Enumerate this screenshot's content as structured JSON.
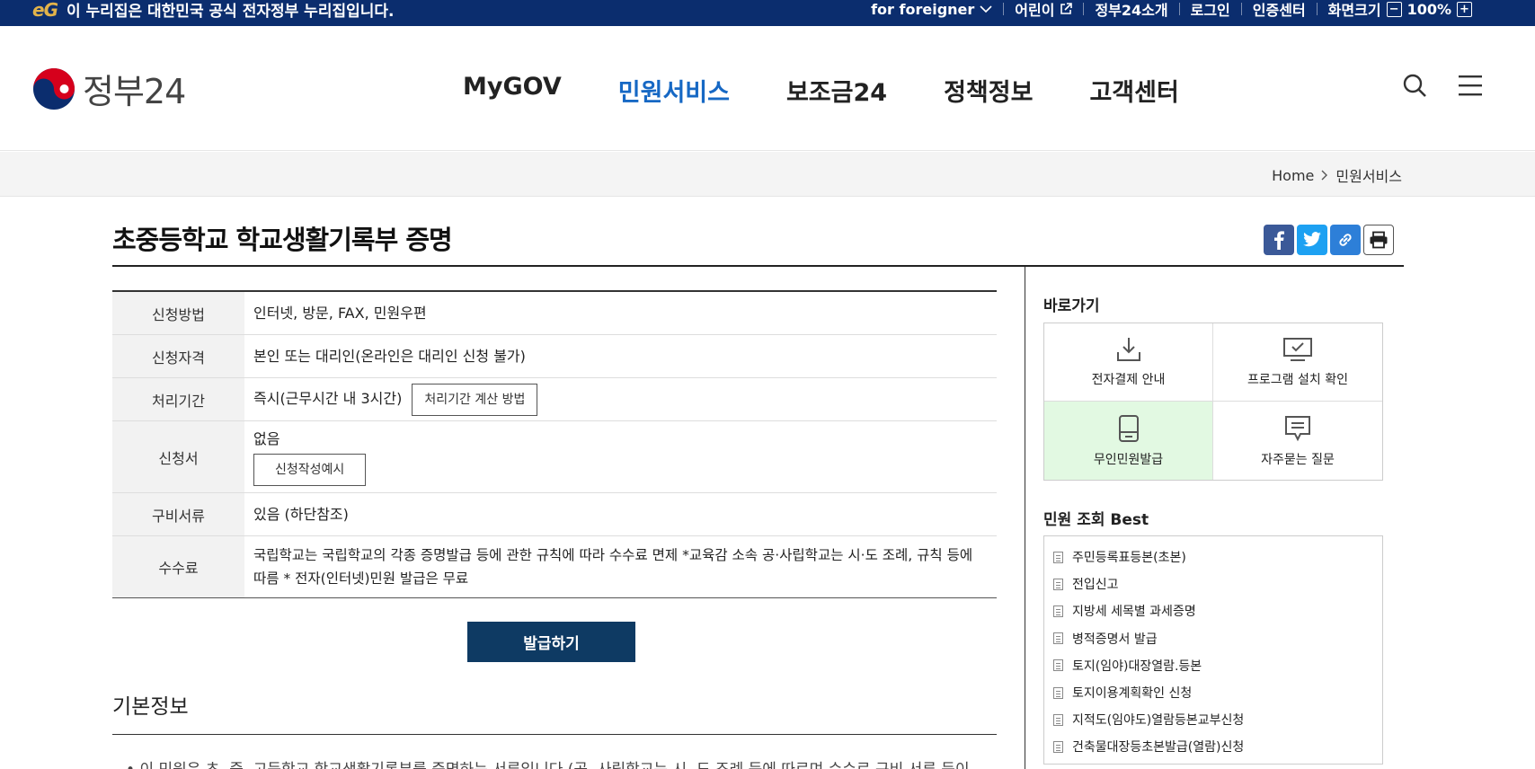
{
  "topbar": {
    "logo_text": "eG",
    "notice": "이 누리집은 대한민국 공식 전자정부 누리집입니다.",
    "util": {
      "foreigner": "for foreigner",
      "kids": "어린이",
      "about": "정부24소개",
      "login": "로그인",
      "cert": "인증센터",
      "screen_size_label": "화면크기",
      "zoom_out": "−",
      "zoom_level": "100%",
      "zoom_in": "+"
    }
  },
  "header": {
    "logo_text": "정부24",
    "nav": [
      "MyGOV",
      "민원서비스",
      "보조금24",
      "정책정보",
      "고객센터"
    ],
    "active_nav_index": 1,
    "icons": [
      "search-icon",
      "menu-icon"
    ]
  },
  "breadcrumb": {
    "home": "Home",
    "current": "민원서비스"
  },
  "page": {
    "title": "초중등학교 학교생활기록부 증명",
    "share_icons": [
      "facebook-icon",
      "twitter-icon",
      "link-icon",
      "print-icon"
    ]
  },
  "info": {
    "method": {
      "label": "신청방법",
      "value": "인터넷, 방문, FAX, 민원우편"
    },
    "qualification": {
      "label": "신청자격",
      "value": "본인 또는 대리인(온라인은 대리인 신청 불가)"
    },
    "period": {
      "label": "처리기간",
      "value": "즉시(근무시간 내 3시간)",
      "button": "처리기간 계산 방법"
    },
    "form": {
      "label": "신청서",
      "value": "없음",
      "button": "신청작성예시"
    },
    "documents": {
      "label": "구비서류",
      "value": "있음 (하단참조)"
    },
    "fee": {
      "label": "수수료",
      "value": "국립학교는 국립학교의 각종 증명발급 등에 관한 규칙에 따라 수수료 면제 *교육감 소속 공·사립학교는 시·도 조례, 규칙 등에 따름 * 전자(인터넷)민원 발급은 무료"
    }
  },
  "issue_button": "발급하기",
  "basic_info": {
    "title": "기본정보",
    "first_line": "이 민원은 초, 중, 고등학교 학교생활기록부를 증명하는 서류입니다.(공, 사립학교는 시, 도 조례 등에 따르며 수수료 구비 서류 등이 상이할 수 있음) 접수는"
  },
  "sidebar": {
    "quick_title": "바로가기",
    "quick_links": [
      {
        "label": "전자결제 안내",
        "icon": "download-icon"
      },
      {
        "label": "프로그램 설치 확인",
        "icon": "monitor-check-icon"
      },
      {
        "label": "무인민원발급",
        "icon": "kiosk-icon"
      },
      {
        "label": "자주묻는 질문",
        "icon": "chat-icon"
      }
    ],
    "best_title": "민원 조회 Best",
    "best_items": [
      "주민등록표등본(초본)",
      "전입신고",
      "지방세 세목별 과세증명",
      "병적증명서 발급",
      "토지(임야)대장열람.등본",
      "토지이용계획확인 신청",
      "지적도(임야도)열람등본교부신청",
      "건축물대장등초본발급(열람)신청"
    ]
  },
  "colors": {
    "topbar_bg": "#0b2d6e",
    "active_nav": "#1668c4",
    "issue_button_bg": "#0e3a63",
    "kiosk_highlight": "#e2f9e2"
  }
}
